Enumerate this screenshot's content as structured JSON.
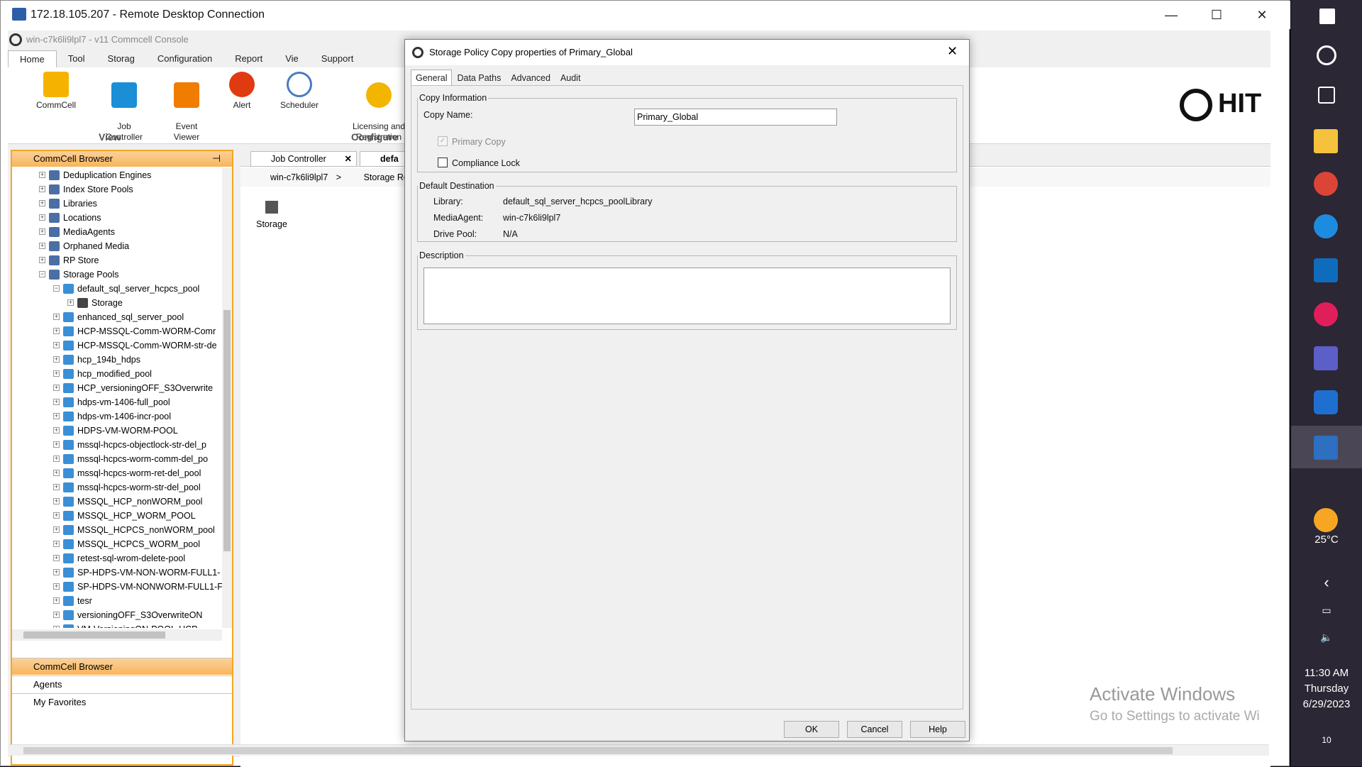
{
  "rdp": {
    "title": "172.18.105.207 - Remote Desktop Connection",
    "minimize": "—",
    "maximize": "☐",
    "close": "✕"
  },
  "console": {
    "title": "win-c7k6li9lpl7 - v11 Commcell Console",
    "tabs": [
      "Home",
      "Tool",
      "Storag",
      "Configuration",
      "Report",
      "Vie",
      "Support"
    ],
    "ribbon": {
      "commcell": "CommCell",
      "job_controller": "Job\nController",
      "event_viewer": "Event\nViewer",
      "alert": "Alert",
      "scheduler": "Scheduler",
      "licensing": "Licensing and\nRegistration",
      "group_view": "View",
      "group_configure": "Configure",
      "brand": "HIT"
    }
  },
  "browser": {
    "header": "CommCell Browser",
    "pin": "⊣",
    "tree": [
      "Deduplication Engines",
      "Index Store Pools",
      "Libraries",
      "Locations",
      "MediaAgents",
      "Orphaned Media",
      "RP Store",
      "Storage Pools",
      "default_sql_server_hcpcs_pool",
      "Storage",
      "enhanced_sql_server_pool",
      "HCP-MSSQL-Comm-WORM-Comr",
      "HCP-MSSQL-Comm-WORM-str-de",
      "hcp_194b_hdps",
      "hcp_modified_pool",
      "HCP_versioningOFF_S3Overwrite",
      "hdps-vm-1406-full_pool",
      "hdps-vm-1406-incr-pool",
      "HDPS-VM-WORM-POOL",
      "mssql-hcpcs-objectlock-str-del_p",
      "mssql-hcpcs-worm-comm-del_po",
      "mssql-hcpcs-worm-ret-del_pool",
      "mssql-hcpcs-worm-str-del_pool",
      "MSSQL_HCP_nonWORM_pool",
      "MSSQL_HCP_WORM_POOL",
      "MSSQL_HCPCS_nonWORM_pool",
      "MSSQL_HCPCS_WORM_pool",
      "retest-sql-wrom-delete-pool",
      "SP-HDPS-VM-NON-WORM-FULL1-",
      "SP-HDPS-VM-NONWORM-FULL1-F",
      "tesr",
      "versioningOFF_S3OverwriteON",
      "VM-VersioningON-POOL-HCP"
    ],
    "nav": [
      "CommCell Browser",
      "Agents",
      "My Favorites"
    ]
  },
  "content": {
    "tab1": "Job Controller",
    "tab2": "defa",
    "breadcrumb1": "win-c7k6li9lpl7",
    "breadcrumb_sep": ">",
    "breadcrumb2": "Storage Re",
    "item": "Storage"
  },
  "dialog": {
    "title": "Storage Policy Copy properties of Primary_Global",
    "tabs": [
      "General",
      "Data Paths",
      "Advanced",
      "Audit"
    ],
    "copy_info_legend": "Copy Information",
    "copy_name_label": "Copy Name:",
    "copy_name_value": "Primary_Global",
    "primary_copy": "Primary Copy",
    "compliance_lock": "Compliance Lock",
    "dest_legend": "Default Destination",
    "library_label": "Library:",
    "library_value": "default_sql_server_hcpcs_poolLibrary",
    "ma_label": "MediaAgent:",
    "ma_value": "win-c7k6li9lpl7",
    "drive_label": "Drive Pool:",
    "drive_value": "N/A",
    "desc_legend": "Description",
    "ok": "OK",
    "cancel": "Cancel",
    "help": "Help"
  },
  "watermark": {
    "line1": "Activate Windows",
    "line2": "Go to Settings to activate Wi"
  },
  "taskbar": {
    "temp": "25°C",
    "time": "11:30 AM",
    "day": "Thursday",
    "date": "6/29/2023",
    "notif": "10"
  }
}
